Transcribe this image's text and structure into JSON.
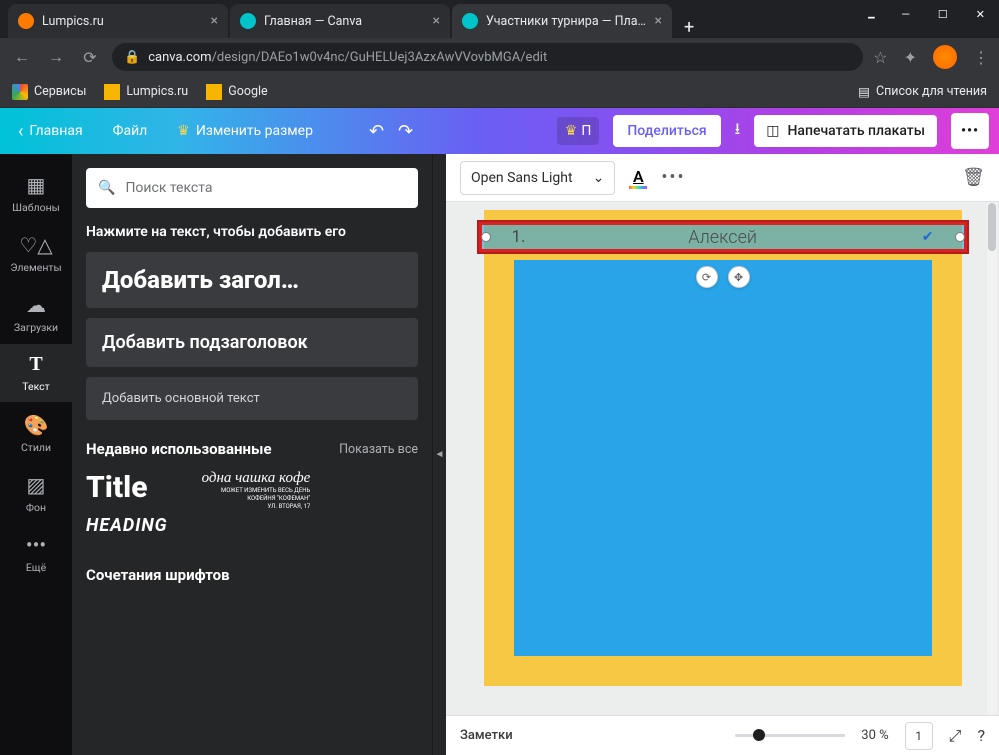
{
  "browser": {
    "tabs": [
      {
        "title": "Lumpics.ru",
        "favicon": "#ff7a00"
      },
      {
        "title": "Главная — Canva",
        "favicon": "#00c4cc"
      },
      {
        "title": "Участники турнира — Плакат",
        "favicon": "#00c4cc",
        "active": true
      }
    ],
    "url_host": "canva.com",
    "url_path": "/design/DAEo1w0v4nc/GuHELUej3AzxAwVVovbMGA/edit",
    "bookmarks": {
      "services": "Сервисы",
      "lumpics": "Lumpics.ru",
      "google": "Google",
      "readlist": "Список для чтения"
    }
  },
  "canva": {
    "topbar": {
      "home": "Главная",
      "file": "Файл",
      "resize": "Изменить размер",
      "pro_badge": "П",
      "share": "Поделиться",
      "print": "Напечатать плакаты"
    },
    "sidenav": {
      "templates": "Шаблоны",
      "elements": "Элементы",
      "uploads": "Загрузки",
      "text": "Текст",
      "styles": "Стили",
      "background": "Фон",
      "more": "Ещё"
    },
    "panel": {
      "search_placeholder": "Поиск текста",
      "hint": "Нажмите на текст, чтобы добавить его",
      "add_heading": "Добавить загол…",
      "add_subheading": "Добавить подзаголовок",
      "add_body": "Добавить основной текст",
      "recent_title": "Недавно использованные",
      "show_all": "Показать все",
      "preset_title": "Title",
      "preset_heading": "HEADING",
      "preset_kofe": "одна чашка кофе",
      "preset_kofe_sub1": "МОЖЕТ ИЗМЕНИТЬ ВЕСЬ ДЕНЬ",
      "preset_kofe_sub2": "КОФЕЙНЯ \"КОФЕМАН\"",
      "preset_kofe_sub3": "УЛ. ВТОРАЯ, 17",
      "combos": "Сочетания шрифтов"
    },
    "context": {
      "font": "Open Sans Light"
    },
    "canvas": {
      "number": "1.",
      "name": "Алексей"
    },
    "footer": {
      "notes": "Заметки",
      "zoom": "30 %",
      "pages": "1"
    }
  },
  "colors": {
    "poster_bg": "#f7c843",
    "poster_inner": "#2aa4e8",
    "highlight": "#d92222"
  }
}
